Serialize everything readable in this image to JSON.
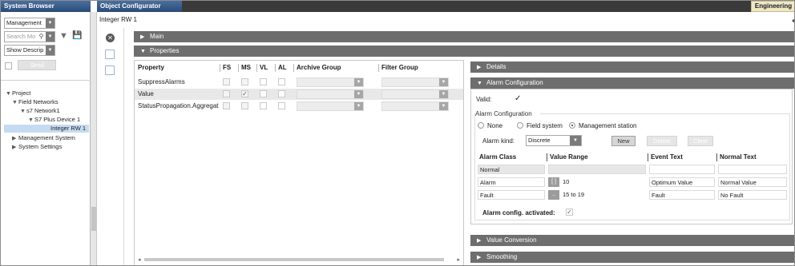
{
  "system_browser": {
    "title": "System Browser",
    "view_combo": "Management",
    "search_placeholder": "Search Mo",
    "display_combo": "Show Descrip",
    "send_label": "Send",
    "tree": [
      {
        "label": "Project",
        "expanded": true,
        "selected": false
      },
      {
        "label": "Field Networks",
        "expanded": true,
        "selected": false
      },
      {
        "label": "s7 Network1",
        "expanded": true,
        "selected": false
      },
      {
        "label": "S7 Plus Device 1",
        "expanded": true,
        "selected": false
      },
      {
        "label": "Integer RW 1",
        "expanded": false,
        "selected": true
      },
      {
        "label": "Management System",
        "expanded": false,
        "selected": false
      },
      {
        "label": "System Settings",
        "expanded": false,
        "selected": false
      }
    ]
  },
  "object_configurator": {
    "title": "Object Configurator",
    "workspace": "Engineering",
    "object_name": "Integer RW 1",
    "sections": {
      "main": "Main",
      "properties": "Properties"
    }
  },
  "properties_grid": {
    "headers": [
      "Property",
      "FS",
      "MS",
      "VL",
      "AL",
      "Archive Group",
      "Filter Group"
    ],
    "rows": [
      {
        "name": "SuppressAlarms",
        "ms_checked": false,
        "selected": false
      },
      {
        "name": "Value",
        "ms_checked": true,
        "selected": true
      },
      {
        "name": "StatusPropagation.Aggregat",
        "ms_checked": false,
        "selected": false
      }
    ]
  },
  "right_panel": {
    "details": "Details",
    "alarm_configuration_header": "Alarm Configuration",
    "valid_label": "Valid:",
    "group_label": "Alarm Configuration",
    "radios": [
      {
        "label": "None",
        "selected": false
      },
      {
        "label": "Field system",
        "selected": false
      },
      {
        "label": "Management station",
        "selected": true
      }
    ],
    "alarm_kind_label": "Alarm kind:",
    "alarm_kind_value": "Discrete",
    "buttons": {
      "new": "New",
      "delete": "Delete",
      "clear": "Clear"
    },
    "alarm_table": {
      "headers": [
        "Alarm Class",
        "Value Range",
        "Event Text",
        "Normal Text"
      ],
      "rows": [
        {
          "class": "Normal",
          "range_icon": "",
          "range": "",
          "event": "",
          "normal": ""
        },
        {
          "class": "Alarm",
          "range_icon": "[ ]",
          "range": "10",
          "event": "Optimum Value",
          "normal": "Normal Value"
        },
        {
          "class": "Fault",
          "range_icon": "..",
          "range": "15  to  19",
          "event": "Fault",
          "normal": "No Fault"
        }
      ]
    },
    "activated_label": "Alarm config. activated:",
    "value_conversion": "Value Conversion",
    "smoothing": "Smoothing"
  }
}
